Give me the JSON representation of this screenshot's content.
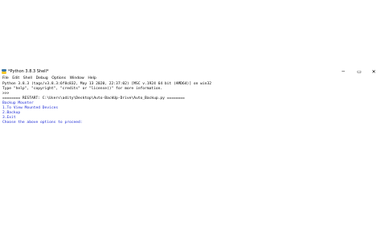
{
  "window": {
    "title": "*Python 3.8.3 Shell*",
    "controls": {
      "minimize": "─",
      "maximize": "▭",
      "close": "✕"
    }
  },
  "menubar": {
    "items": [
      "File",
      "Edit",
      "Shell",
      "Debug",
      "Options",
      "Window",
      "Help"
    ]
  },
  "shell": {
    "lines": [
      {
        "text": "Python 3.8.3 (tags/v3.8.3:6f8c832, May 13 2020, 22:37:02) [MSC v.1924 64 bit (AMD64)] on win32",
        "color": "black"
      },
      {
        "text": "Type \"help\", \"copyright\", \"credits\" or \"license()\" for more information.",
        "color": "black"
      },
      {
        "text": ">>> ",
        "color": "black"
      },
      {
        "text": "======== RESTART: C:\\Users\\adity\\Desktop\\Auto-BackUp-Drive\\Auto_Backup.py ========",
        "color": "black"
      },
      {
        "text": "Backup Mounter",
        "color": "blue"
      },
      {
        "text": "1.To View Mounted Devices",
        "color": "blue"
      },
      {
        "text": "2.Backup",
        "color": "blue"
      },
      {
        "text": "3.Exit",
        "color": "blue"
      },
      {
        "text": "Choose the above options to proceed:",
        "color": "blue"
      }
    ]
  },
  "colors": {
    "stdout": "#1d2bd6",
    "text": "#000000",
    "background": "#ffffff"
  }
}
